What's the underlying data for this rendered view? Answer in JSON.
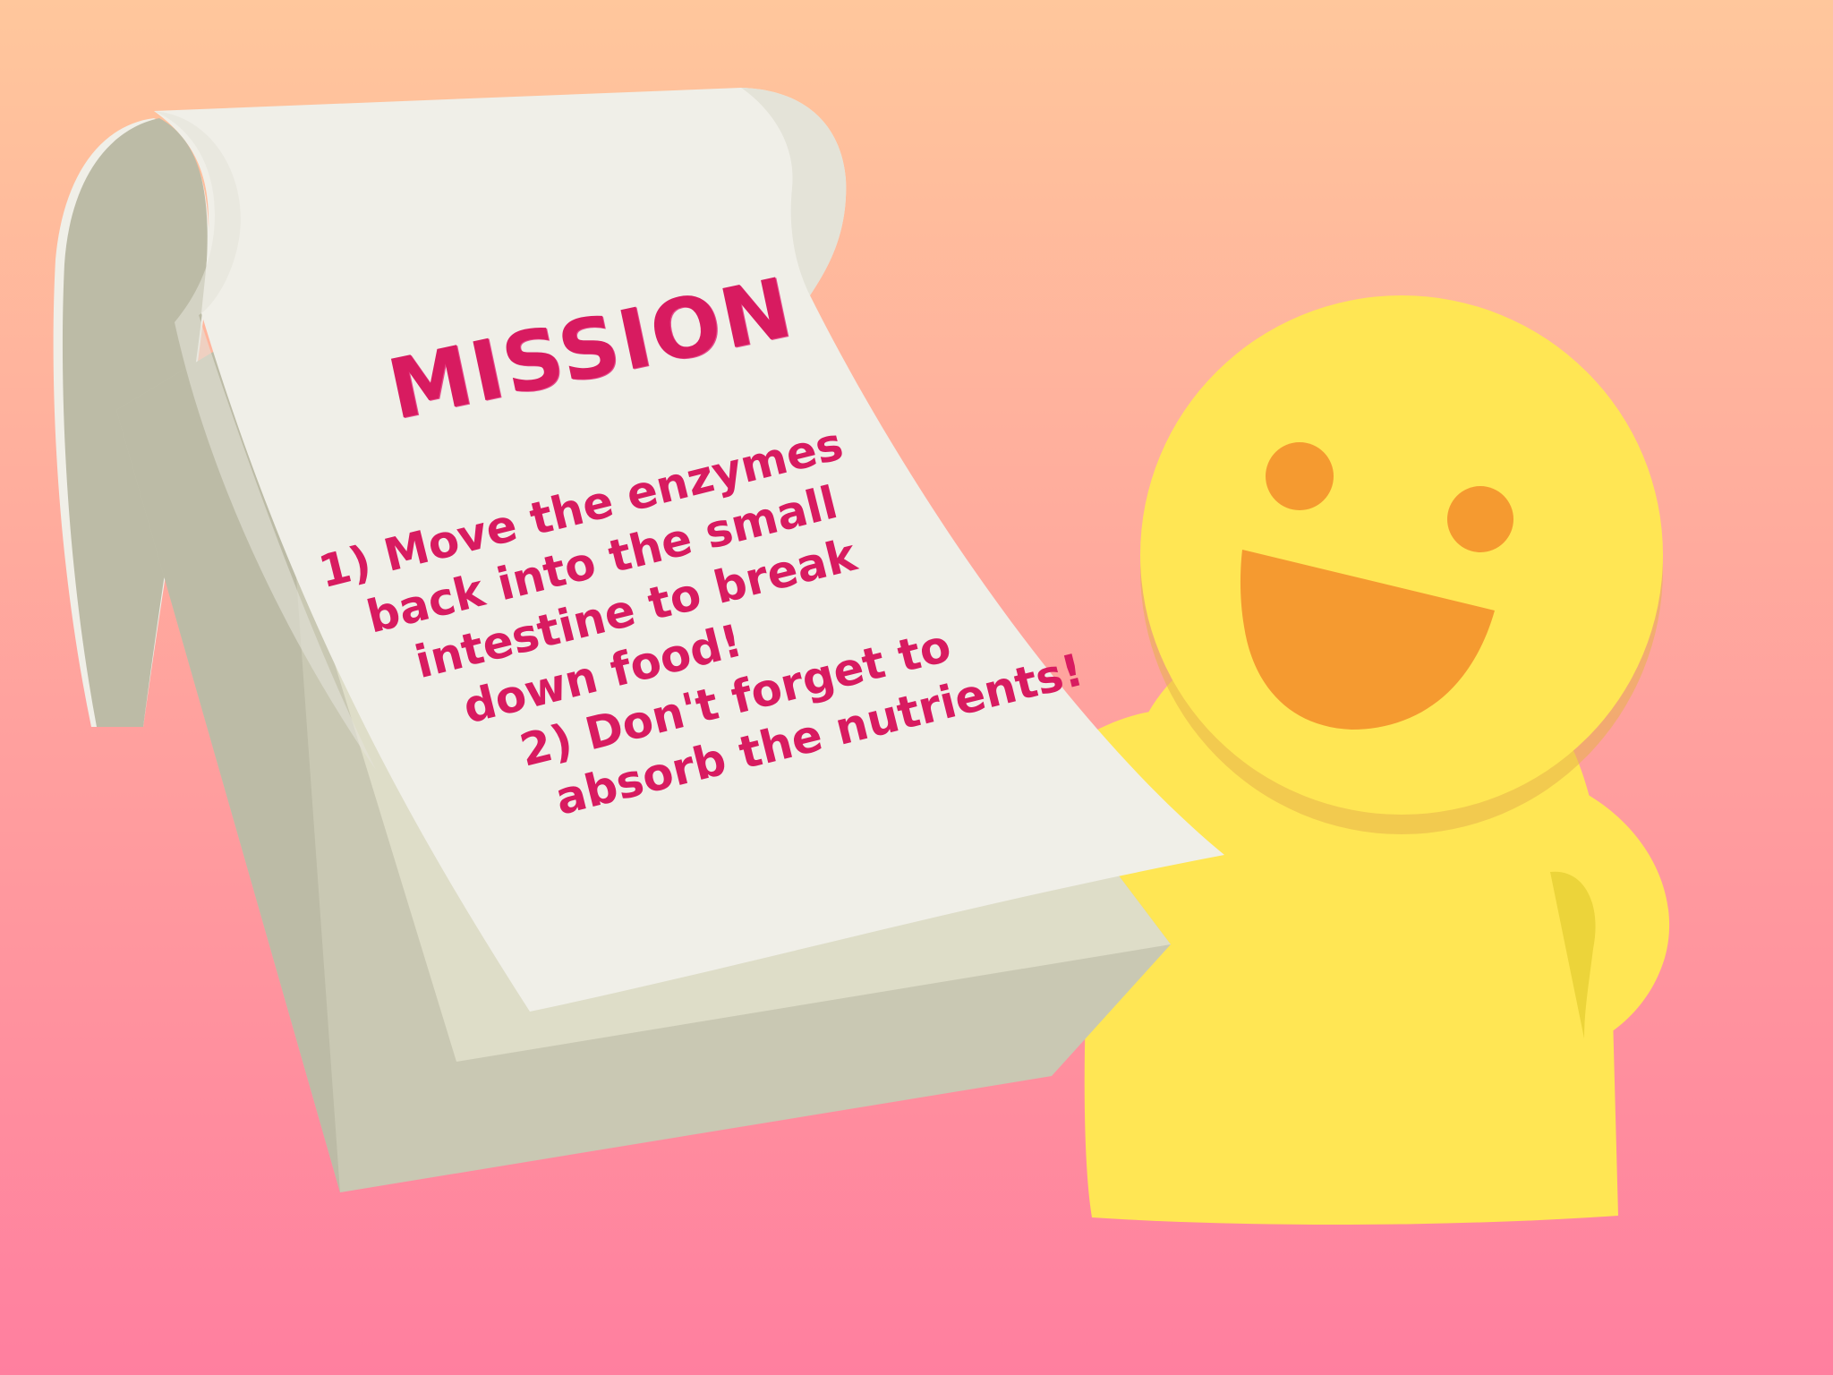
{
  "mission": {
    "title": "MISSION",
    "lines": [
      "1) Move the enzymes",
      "back into the small",
      "intestine to break",
      "down food!",
      "2) Don't forget to",
      "absorb the nutrients!"
    ]
  },
  "colors": {
    "background_top": "#ffc79c",
    "background_bottom": "#ff7f9f",
    "mission_text": "#d81b60",
    "paper": "#f0efe8",
    "pad_side": "#c9c8b3",
    "character_body": "#ffe654",
    "character_features": "#f59a30"
  },
  "icons": {
    "character": "smiling-yellow-character",
    "notepad": "notepad-icon"
  }
}
